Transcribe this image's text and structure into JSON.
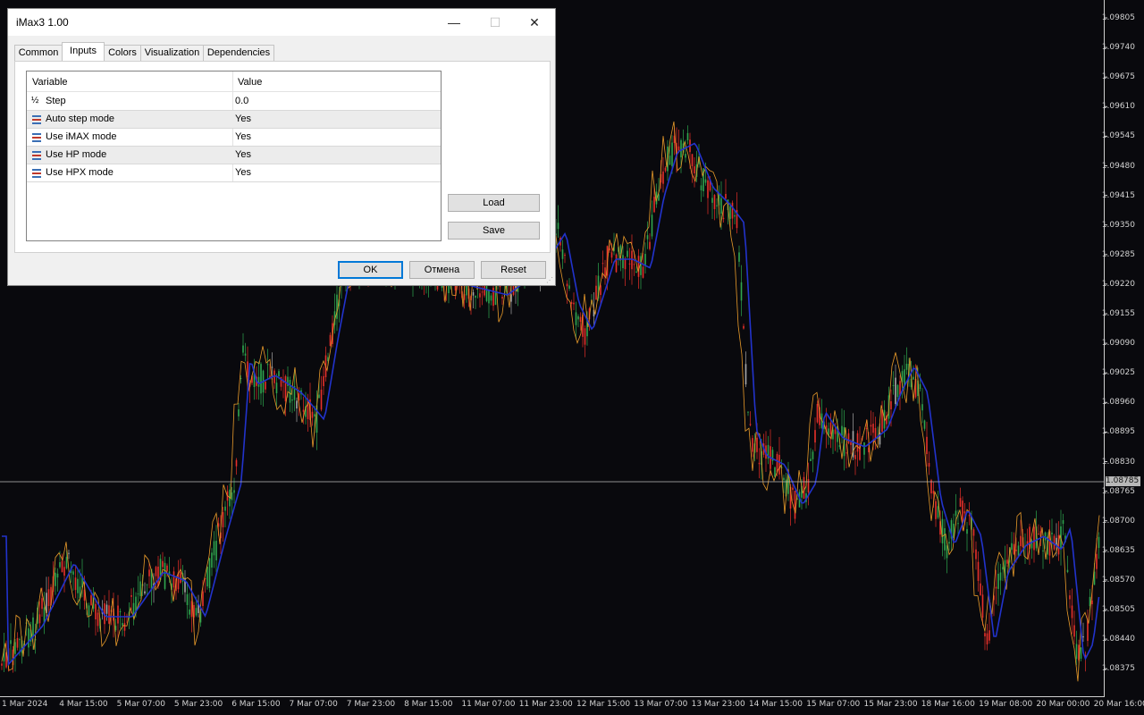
{
  "window": {
    "title": "iMax3 1.00",
    "controls": {
      "minimize": "—",
      "maximize": "☐",
      "close": "✕"
    }
  },
  "tabs": [
    {
      "label": "Common",
      "active": false
    },
    {
      "label": "Inputs",
      "active": true
    },
    {
      "label": "Colors",
      "active": false
    },
    {
      "label": "Visualization",
      "active": false
    },
    {
      "label": "Dependencies",
      "active": false
    }
  ],
  "inputs_table": {
    "columns": [
      "Variable",
      "Value"
    ],
    "rows": [
      {
        "icon": "fraction-icon",
        "variable": "Step",
        "value": "0.0"
      },
      {
        "icon": "list-icon",
        "variable": "Auto step mode",
        "value": "Yes"
      },
      {
        "icon": "list-icon",
        "variable": "Use iMAX mode",
        "value": "Yes"
      },
      {
        "icon": "list-icon",
        "variable": "Use HP mode",
        "value": "Yes"
      },
      {
        "icon": "list-icon",
        "variable": "Use HPX mode",
        "value": "Yes"
      }
    ]
  },
  "side_buttons": {
    "load": "Load",
    "save": "Save"
  },
  "footer_buttons": {
    "ok": "OK",
    "cancel": "Отмена",
    "reset": "Reset"
  },
  "chart": {
    "background": "#09090d",
    "current_price": "1.08785",
    "price_axis": [
      "1.09805",
      "1.09740",
      "1.09675",
      "1.09610",
      "1.09545",
      "1.09480",
      "1.09415",
      "1.09350",
      "1.09285",
      "1.09220",
      "1.09155",
      "1.09090",
      "1.09025",
      "1.08960",
      "1.08895",
      "1.08830",
      "1.08765",
      "1.08700",
      "1.08635",
      "1.08570",
      "1.08505",
      "1.08440",
      "1.08375"
    ],
    "time_axis": [
      "1 Mar 2024",
      "4 Mar 15:00",
      "5 Mar 07:00",
      "5 Mar 23:00",
      "6 Mar 15:00",
      "7 Mar 07:00",
      "7 Mar 23:00",
      "8 Mar 15:00",
      "11 Mar 07:00",
      "11 Mar 23:00",
      "12 Mar 15:00",
      "13 Mar 07:00",
      "13 Mar 23:00",
      "14 Mar 15:00",
      "15 Mar 07:00",
      "15 Mar 23:00",
      "18 Mar 16:00",
      "19 Mar 08:00",
      "20 Mar 00:00",
      "20 Mar 16:00"
    ],
    "colors": {
      "bull": "#2fa84f",
      "bear": "#e8302a",
      "neutral": "#a9a9a9",
      "imax": "#2233cc",
      "hpx": "#e89a2a"
    }
  }
}
